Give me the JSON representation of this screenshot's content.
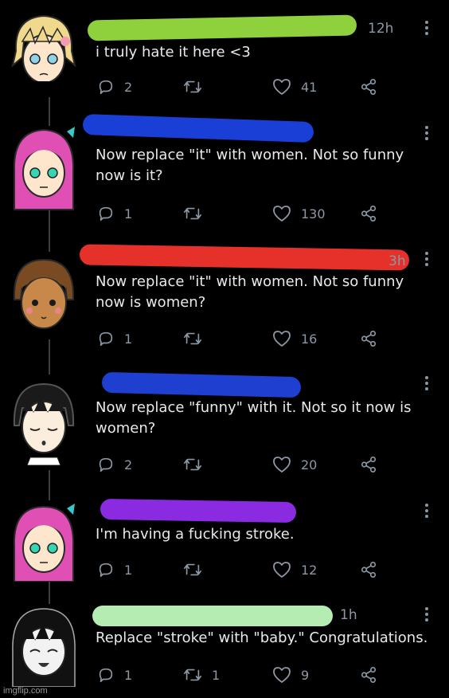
{
  "tweets": [
    {
      "time": "12h",
      "text": "i truly hate it here <3",
      "replies": "2",
      "retweets": "",
      "likes": "41",
      "redaction_color": "#8fd13c",
      "avatar": "blonde-character"
    },
    {
      "time": "",
      "text": "Now replace \"it\" with women. Not so funny now is it?",
      "replies": "1",
      "retweets": "",
      "likes": "130",
      "redaction_color": "#1a3fd6",
      "avatar": "pink-hair-character"
    },
    {
      "time": "3h",
      "text": "Now replace \"it\" with women. Not so funny now is women?",
      "replies": "1",
      "retweets": "",
      "likes": "16",
      "redaction_color": "#e5312a",
      "avatar": "brown-hair-character"
    },
    {
      "time": "",
      "text": "Now replace \"funny\" with it. Not so it now is women?",
      "replies": "2",
      "retweets": "",
      "likes": "20",
      "redaction_color": "#1f3fd0",
      "avatar": "black-hair-character"
    },
    {
      "time": "",
      "text": "I'm having a fucking stroke.",
      "replies": "1",
      "retweets": "",
      "likes": "12",
      "redaction_color": "#8a2be2",
      "avatar": "pink-hair-character"
    },
    {
      "time": "1h",
      "text": "Replace \"stroke\" with \"baby.\" Congratulations.",
      "replies": "1",
      "retweets": "1",
      "likes": "9",
      "redaction_color": "#b5ecb2",
      "avatar": "monochrome-character"
    }
  ],
  "watermark": "imgflip.com",
  "icons": {
    "reply": "reply-icon",
    "retweet": "retweet-icon",
    "like": "heart-icon",
    "share": "share-icon",
    "more": "more-dots-icon"
  },
  "colors": {
    "background": "#000000",
    "text": "#e7e9ea",
    "muted": "#8b98a5",
    "thread_line": "#3a3d41"
  }
}
